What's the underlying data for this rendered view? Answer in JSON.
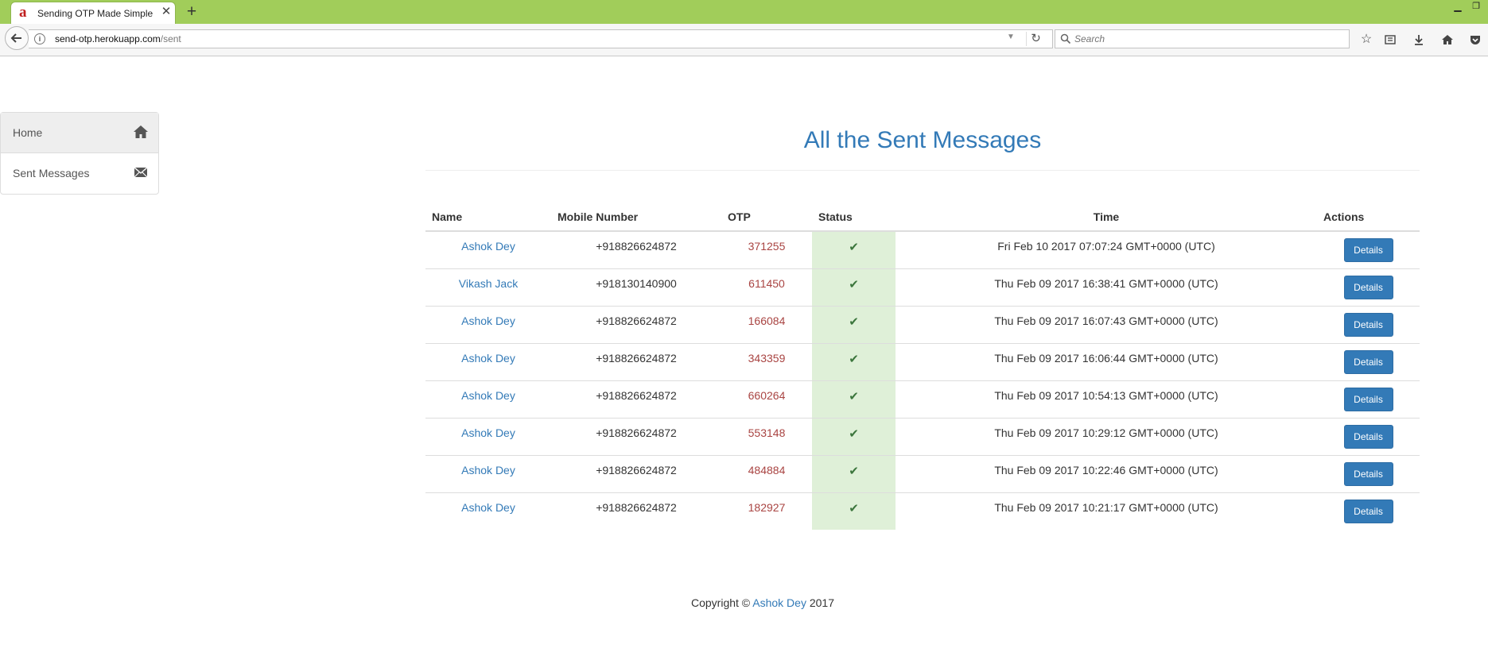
{
  "browser": {
    "tab_logo": "a",
    "tab_title": "Sending OTP Made Simple",
    "tab_close": "✕",
    "new_tab": "+",
    "url_domain": "send-otp.herokuapp.com",
    "url_path": "/sent",
    "search_placeholder": "Search"
  },
  "sidebar": {
    "items": [
      {
        "label": "Home",
        "icon": "home-icon",
        "active": true
      },
      {
        "label": "Sent Messages",
        "icon": "envelope-icon",
        "active": false
      }
    ]
  },
  "main": {
    "title": "All the Sent Messages",
    "table": {
      "headers": [
        "Name",
        "Mobile Number",
        "OTP",
        "Status",
        "Time",
        "Actions"
      ],
      "rows": [
        {
          "name": "Ashok Dey",
          "mobile": "+918826624872",
          "otp": "371255",
          "status": "sent",
          "time": "Fri Feb 10 2017 07:07:24 GMT+0000 (UTC)",
          "action": "Details"
        },
        {
          "name": "Vikash Jack",
          "mobile": "+918130140900",
          "otp": "611450",
          "status": "sent",
          "time": "Thu Feb 09 2017 16:38:41 GMT+0000 (UTC)",
          "action": "Details"
        },
        {
          "name": "Ashok Dey",
          "mobile": "+918826624872",
          "otp": "166084",
          "status": "sent",
          "time": "Thu Feb 09 2017 16:07:43 GMT+0000 (UTC)",
          "action": "Details"
        },
        {
          "name": "Ashok Dey",
          "mobile": "+918826624872",
          "otp": "343359",
          "status": "sent",
          "time": "Thu Feb 09 2017 16:06:44 GMT+0000 (UTC)",
          "action": "Details"
        },
        {
          "name": "Ashok Dey",
          "mobile": "+918826624872",
          "otp": "660264",
          "status": "sent",
          "time": "Thu Feb 09 2017 10:54:13 GMT+0000 (UTC)",
          "action": "Details"
        },
        {
          "name": "Ashok Dey",
          "mobile": "+918826624872",
          "otp": "553148",
          "status": "sent",
          "time": "Thu Feb 09 2017 10:29:12 GMT+0000 (UTC)",
          "action": "Details"
        },
        {
          "name": "Ashok Dey",
          "mobile": "+918826624872",
          "otp": "484884",
          "status": "sent",
          "time": "Thu Feb 09 2017 10:22:46 GMT+0000 (UTC)",
          "action": "Details"
        },
        {
          "name": "Ashok Dey",
          "mobile": "+918826624872",
          "otp": "182927",
          "status": "sent",
          "time": "Thu Feb 09 2017 10:21:17 GMT+0000 (UTC)",
          "action": "Details"
        }
      ]
    }
  },
  "footer": {
    "prefix": "Copyright ©",
    "author": "Ashok Dey",
    "year": "2017"
  },
  "colors": {
    "tabbar": "#a1cd5a",
    "link": "#337ab7",
    "otp": "#a94442",
    "status_bg": "#dff0d8",
    "status_check": "#3c763d",
    "button": "#337ab7"
  }
}
